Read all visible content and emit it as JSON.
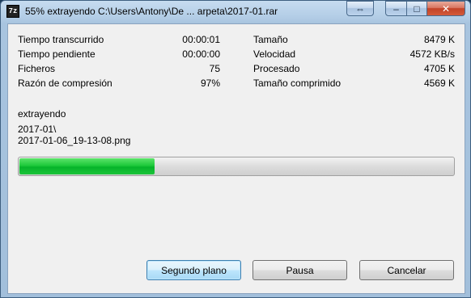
{
  "window": {
    "title": "55% extrayendo C:\\Users\\Antony\\De ... arpeta\\2017-01.rar",
    "app_icon": "7z"
  },
  "caption_buttons": {
    "swap_icon": "⇔",
    "minimize_icon": "–",
    "maximize_icon": "□",
    "close_icon": "✕"
  },
  "stats_left": [
    {
      "label": "Tiempo transcurrido",
      "value": "00:00:01"
    },
    {
      "label": "Tiempo pendiente",
      "value": "00:00:00"
    },
    {
      "label": "Ficheros",
      "value": "75"
    },
    {
      "label": "Razón de compresión",
      "value": "97%"
    }
  ],
  "stats_right": [
    {
      "label": "Tamaño",
      "value": "8479 K"
    },
    {
      "label": "Velocidad",
      "value": "4572 KB/s"
    },
    {
      "label": "Procesado",
      "value": "4705 K"
    },
    {
      "label": "Tamaño comprimido",
      "value": "4569 K"
    }
  ],
  "operation": "extrayendo",
  "current_folder": "2017-01\\",
  "current_file": "2017-01-06_19-13-08.png",
  "progress": 0.31,
  "buttons": {
    "background": "Segundo plano",
    "pause": "Pausa",
    "cancel": "Cancelar"
  }
}
